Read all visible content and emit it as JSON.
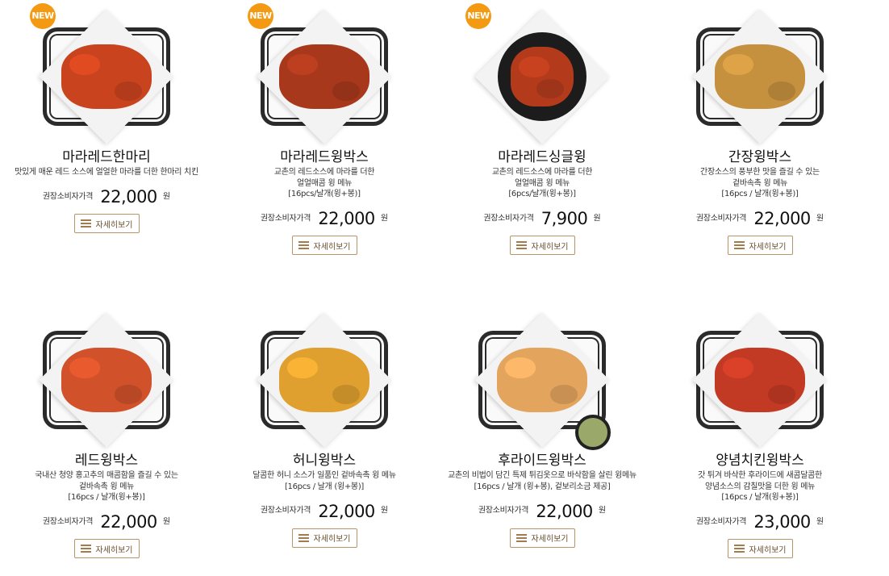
{
  "price_label": "권장소비자가격",
  "currency_unit": "원",
  "detail_label": "자세히보기",
  "badge_new": "NEW",
  "products": [
    {
      "name": "마라레드한마리",
      "desc": [
        "맛있게 매운 레드 소스에 얼얼한 마라를 더한 한마리 치킨"
      ],
      "price": "22,000",
      "badge": true,
      "color": "#c9431e",
      "dish": "basket"
    },
    {
      "name": "마라레드윙박스",
      "desc": [
        "교촌의 레드소스에 마라를 더한",
        "얼얼매콤 윙 메뉴",
        "[16pcs/날개(윙+봉)]"
      ],
      "price": "22,000",
      "badge": true,
      "color": "#a8381c",
      "dish": "basket"
    },
    {
      "name": "마라레드싱글윙",
      "desc": [
        "교촌의 레드소스에 마라를 더한",
        "얼얼매콤 윙 메뉴",
        "[6pcs/날개(윙+봉)]"
      ],
      "price": "7,900",
      "badge": true,
      "color": "#b33b1c",
      "dish": "plate"
    },
    {
      "name": "간장윙박스",
      "desc": [
        "간장소스의 풍부한 맛을 즐길 수 있는",
        "겉바속촉 윙 메뉴",
        "[16pcs / 날개(윙+봉)]"
      ],
      "price": "22,000",
      "badge": false,
      "color": "#c6913f",
      "dish": "basket"
    },
    {
      "name": "레드윙박스",
      "desc": [
        "국내산 청양 홍고추의 매콤함을 즐길 수 있는",
        "겉바속촉 윙 메뉴",
        "[16pcs / 날개(윙+봉)]"
      ],
      "price": "22,000",
      "badge": false,
      "color": "#d0512a",
      "dish": "basket"
    },
    {
      "name": "허니윙박스",
      "desc": [
        "달콤한 허니 소스가 일품인 겉바속촉 윙 메뉴",
        "[16pcs / 날개 (윙+봉)]"
      ],
      "price": "22,000",
      "badge": false,
      "color": "#e0a030",
      "dish": "basket"
    },
    {
      "name": "후라이드윙박스",
      "desc": [
        "교촌의 비법이 담긴 특제 튀김옷으로 바삭함을 살린 윙메뉴",
        "[16pcs / 날개 (윙+봉), 겉보리소금 제공]"
      ],
      "price": "22,000",
      "badge": false,
      "color": "#e3a45e",
      "dish": "basket",
      "dip": true
    },
    {
      "name": "양념치킨윙박스",
      "desc": [
        "갓 튀겨 바삭한 후라이드에 새콤달콤한",
        "양념소스의 감칠맛을 더한 윙 메뉴",
        "[16pcs / 날개(윙+봉)]"
      ],
      "price": "23,000",
      "badge": false,
      "color": "#c33a24",
      "dish": "basket"
    }
  ]
}
